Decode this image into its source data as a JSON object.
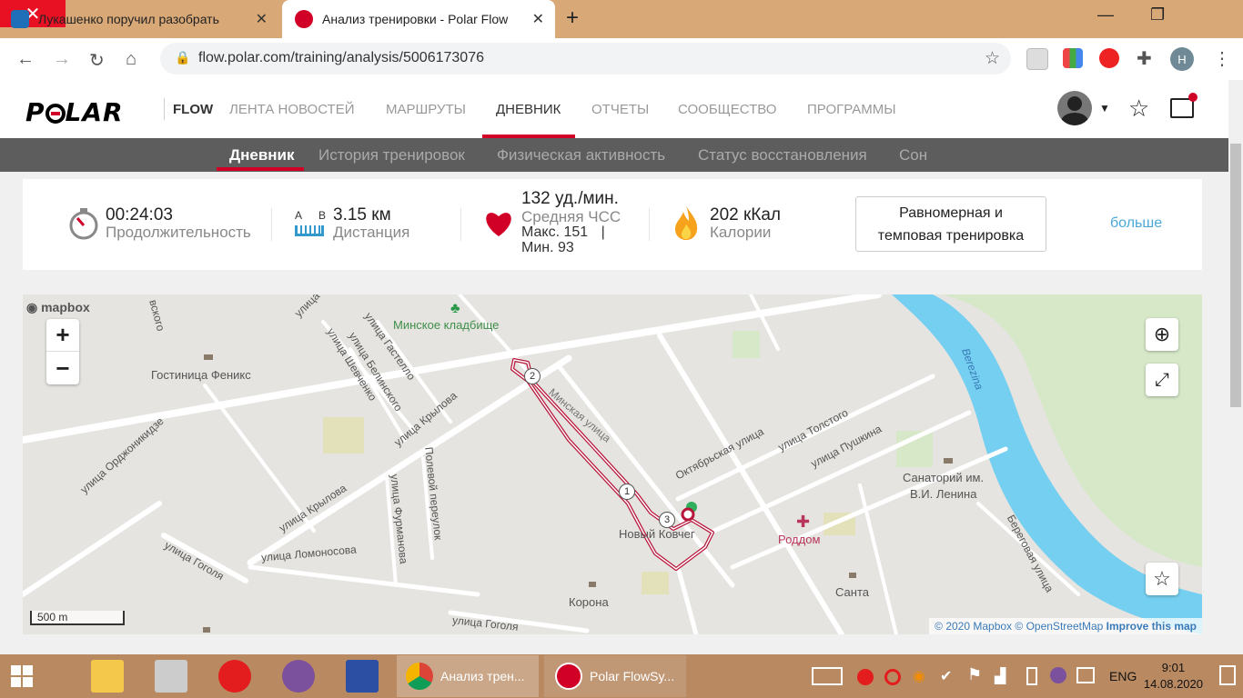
{
  "browser": {
    "tabs": [
      {
        "title": "Лукашенко поручил разобрать"
      },
      {
        "title": "Анализ тренировки - Polar Flow"
      }
    ],
    "url": "flow.polar.com/training/analysis/5006173076",
    "profile_initial": "H"
  },
  "site": {
    "logo": "POLAR",
    "product": "FLOW",
    "nav": [
      "ЛЕНТА НОВОСТЕЙ",
      "МАРШРУТЫ",
      "ДНЕВНИК",
      "ОТЧЕТЫ",
      "СООБЩЕСТВО",
      "ПРОГРАММЫ"
    ],
    "subnav": [
      "Дневник",
      "История тренировок",
      "Физическая активность",
      "Статус восстановления",
      "Сон"
    ]
  },
  "summary": {
    "duration": {
      "value": "00:24:03",
      "label": "Продолжительность"
    },
    "distance": {
      "a": "A",
      "b": "B",
      "value": "3.15 км",
      "label": "Дистанция"
    },
    "heart_rate": {
      "value": "132 уд./мин.",
      "label": "Средняя ЧСС",
      "max": "Макс. 151",
      "sep": "|",
      "min": "Мин. 93"
    },
    "calories": {
      "value": "202 кКал",
      "label": "Калории"
    },
    "tag_line1": "Равномерная и",
    "tag_line2": "темповая тренировка",
    "more": "больше"
  },
  "map": {
    "brand": "mapbox",
    "zoom_in": "+",
    "zoom_out": "−",
    "scale": "500 m",
    "labels": {
      "cemetery": "Минское кладбище",
      "hotel": "Гостиница Феникс",
      "river": "Berezina",
      "sanatorium1": "Санаторий им.",
      "sanatorium2": "В.И. Ленина",
      "maternity": "Роддом",
      "ark": "Новый Ковчег",
      "korona": "Корона",
      "santa": "Санта",
      "st_gastello": "улица Гастелло",
      "st_shevchenko": "улица Шевченко",
      "st_belinsky": "улица Белинского",
      "st_krylova1": "улица Крылова",
      "st_krylova2": "улица Крылова",
      "st_ordzhonikidze": "улица Орджоникидзе",
      "st_polevoy": "Полевой переулок",
      "st_furmanova": "улица Фурманова",
      "st_lomonosova": "улица Ломоносова",
      "st_gogolya1": "улица Гоголя",
      "st_gogolya2": "улица Гоголя",
      "st_oktyabrskaya": "Октябрьская улица",
      "st_tolstogo": "улица Толстого",
      "st_pushkina": "улица Пушкина",
      "st_beregovaya": "Береговая улица",
      "st_minskaya": "Минская улица",
      "st_top_left": "улица",
      "st_top_left2": "вского"
    },
    "markers": [
      "1",
      "2",
      "3"
    ],
    "attribution": {
      "copy": "© 2020 Mapbox ©",
      "osm": "OpenStreetMap",
      "improve": "Improve this map"
    }
  },
  "taskbar": {
    "windows": [
      "Анализ трен...",
      "Polar FlowSy..."
    ],
    "lang": "ENG",
    "time": "9:01",
    "date": "14.08.2020"
  }
}
